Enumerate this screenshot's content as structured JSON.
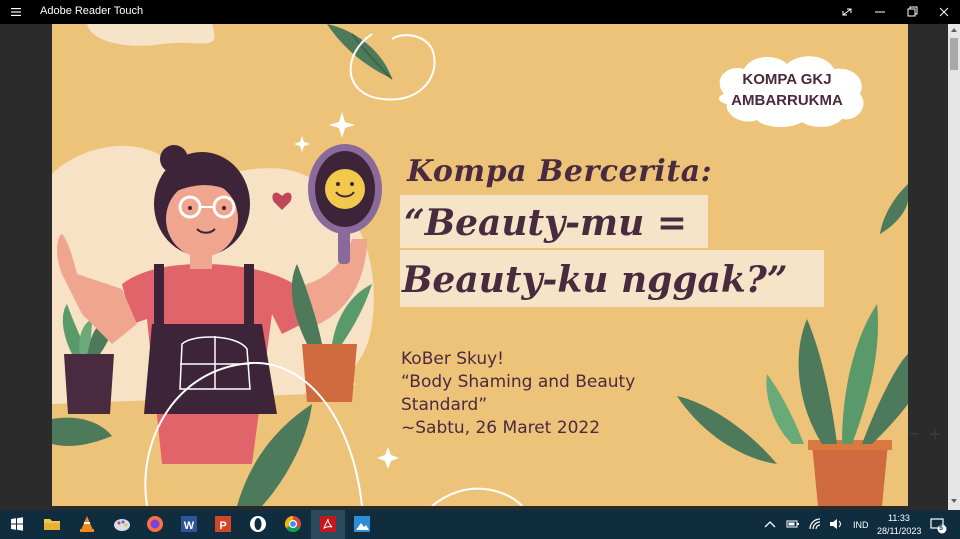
{
  "window": {
    "title": "Adobe Reader Touch"
  },
  "slide": {
    "badge_line1": "KOMPA GKJ",
    "badge_line2": "AMBARRUKMA",
    "heading": "Kompa Bercerita:",
    "highlight_line1": "“Beauty-mu =",
    "highlight_line2": "Beauty-ku nggak?”",
    "body_line1": "KoBer Skuy!",
    "body_line2": "“Body Shaming and Beauty",
    "body_line3": "Standard”",
    "body_line4": "~Sabtu, 26 Maret 2022"
  },
  "taskbar": {
    "apps": [
      "start-icon",
      "file-explorer-icon",
      "vlc-icon",
      "paint-icon",
      "firefox-icon",
      "word-icon",
      "powerpoint-icon",
      "opera-icon",
      "chrome-icon",
      "adobe-reader-icon",
      "photos-icon"
    ],
    "language": "IND",
    "time": "11:33",
    "date": "28/11/2023",
    "notification_count": "5"
  },
  "colors": {
    "slide_background": "#edc37a",
    "text_purple": "#4a2a3e",
    "highlight_box": "#f6e4c8",
    "taskbar": "#0f2d3f"
  }
}
